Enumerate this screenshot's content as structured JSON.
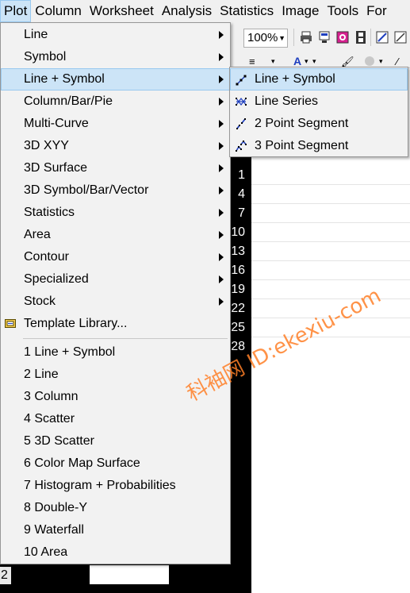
{
  "menubar": {
    "items": [
      "Plot",
      "Column",
      "Worksheet",
      "Analysis",
      "Statistics",
      "Image",
      "Tools",
      "For"
    ]
  },
  "toolbar": {
    "zoom_value": "100%",
    "icons": [
      "print-icon",
      "print-preview-icon",
      "export-icon",
      "film-icon",
      "edit-icon",
      "window-icon"
    ]
  },
  "plot_menu": {
    "submenu_items": [
      {
        "label": "Line",
        "has_submenu": true
      },
      {
        "label": "Symbol",
        "has_submenu": true
      },
      {
        "label": "Line + Symbol",
        "has_submenu": true,
        "highlighted": true
      },
      {
        "label": "Column/Bar/Pie",
        "has_submenu": true
      },
      {
        "label": "Multi-Curve",
        "has_submenu": true
      },
      {
        "label": "3D XYY",
        "has_submenu": true
      },
      {
        "label": "3D Surface",
        "has_submenu": true
      },
      {
        "label": "3D Symbol/Bar/Vector",
        "has_submenu": true
      },
      {
        "label": "Statistics",
        "has_submenu": true
      },
      {
        "label": "Area",
        "has_submenu": true
      },
      {
        "label": "Contour",
        "has_submenu": true
      },
      {
        "label": "Specialized",
        "has_submenu": true
      },
      {
        "label": "Stock",
        "has_submenu": true
      }
    ],
    "template_library": "Template Library...",
    "recent_items": [
      "1 Line + Symbol",
      "2 Line",
      "3 Column",
      "4 Scatter",
      "5 3D Scatter",
      "6 Color Map Surface",
      "7 Histogram + Probabilities",
      "8 Double-Y",
      "9 Waterfall",
      "10 Area"
    ]
  },
  "line_symbol_submenu": {
    "items": [
      {
        "label": "Line + Symbol",
        "icon": "line-symbol-icon",
        "highlighted": true
      },
      {
        "label": "Line Series",
        "icon": "line-series-icon"
      },
      {
        "label": "2 Point Segment",
        "icon": "two-point-segment-icon"
      },
      {
        "label": "3 Point Segment",
        "icon": "three-point-segment-icon"
      }
    ]
  },
  "worksheet": {
    "row_numbers": [
      "1",
      "4",
      "7",
      "10",
      "13",
      "16",
      "19",
      "22",
      "25",
      "28"
    ],
    "bottom_row_number": "2"
  },
  "watermark": "科袖网  ID:ekexiu-com",
  "colors": {
    "menu_bg": "#f2f2f2",
    "highlight_bg": "#cce4f7",
    "highlight_border": "#99c9ef",
    "watermark": "#ff7f27",
    "icon_blue": "#1f3fbf"
  }
}
